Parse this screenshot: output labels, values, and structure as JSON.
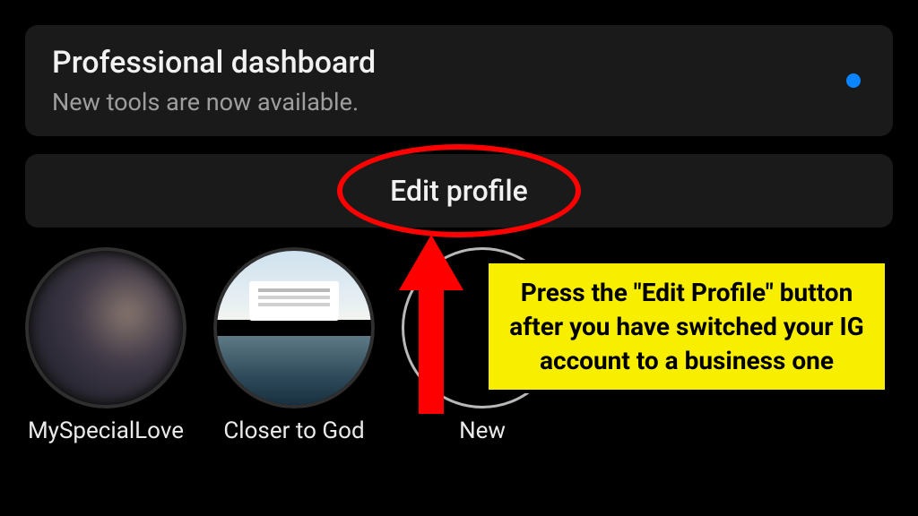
{
  "dashboard": {
    "title": "Professional dashboard",
    "subtitle": "New tools are now available."
  },
  "edit_profile": {
    "label": "Edit profile"
  },
  "stories": {
    "items": [
      {
        "label": "MySpecialLove"
      },
      {
        "label": "Closer to God"
      },
      {
        "label": "New"
      }
    ]
  },
  "annotation": {
    "text": "Press the \"Edit Profile\" button after you have switched your IG account to a business one"
  },
  "colors": {
    "accent": "#0a84ff",
    "annotation_bg": "#f8ef00",
    "highlight": "#ff0000"
  }
}
